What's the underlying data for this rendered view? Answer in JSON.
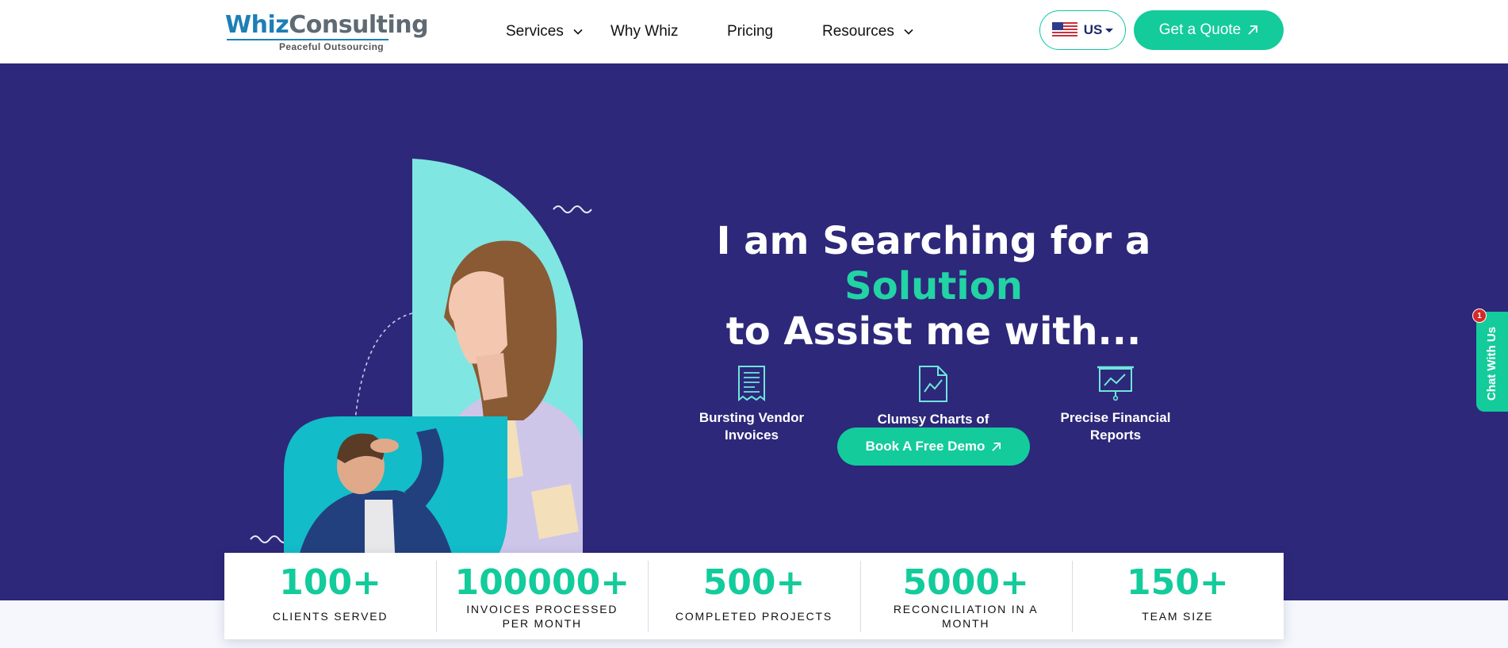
{
  "brand": {
    "name_part1": "Whiz",
    "name_part2": "Consulting",
    "tagline": "Peaceful Outsourcing"
  },
  "nav": {
    "items": [
      {
        "label": "Services",
        "has_dropdown": true
      },
      {
        "label": "Why Whiz",
        "has_dropdown": false
      },
      {
        "label": "Pricing",
        "has_dropdown": false
      },
      {
        "label": "Resources",
        "has_dropdown": true
      }
    ],
    "language": {
      "code": "US",
      "flag_icon": "us-flag-icon"
    },
    "cta_label": "Get a Quote"
  },
  "hero": {
    "headline_part1": "I am Searching for a ",
    "headline_accent": "Solution",
    "headline_part2": "to Assist me with...",
    "features": [
      {
        "label": "Bursting Vendor Invoices",
        "icon": "invoice-receipt-icon"
      },
      {
        "label": "Clumsy Charts of Accounts",
        "icon": "document-chart-icon"
      },
      {
        "label": "Precise Financial Reports",
        "icon": "presentation-board-icon"
      }
    ],
    "demo_label": "Book A Free Demo"
  },
  "chat": {
    "label": "Chat With Us",
    "badge": "1"
  },
  "stats": [
    {
      "value": "100+",
      "label": "Clients Served"
    },
    {
      "value": "100000+",
      "label": "Invoices Processed per Month"
    },
    {
      "value": "500+",
      "label": "Completed Projects"
    },
    {
      "value": "5000+",
      "label": "Reconciliation in a Month"
    },
    {
      "value": "150+",
      "label": "Team Size"
    }
  ],
  "colors": {
    "hero_bg": "#2d287a",
    "accent_green": "#13cb9b",
    "brand_blue": "#1d7fb5",
    "brand_gray": "#5f6a73"
  }
}
